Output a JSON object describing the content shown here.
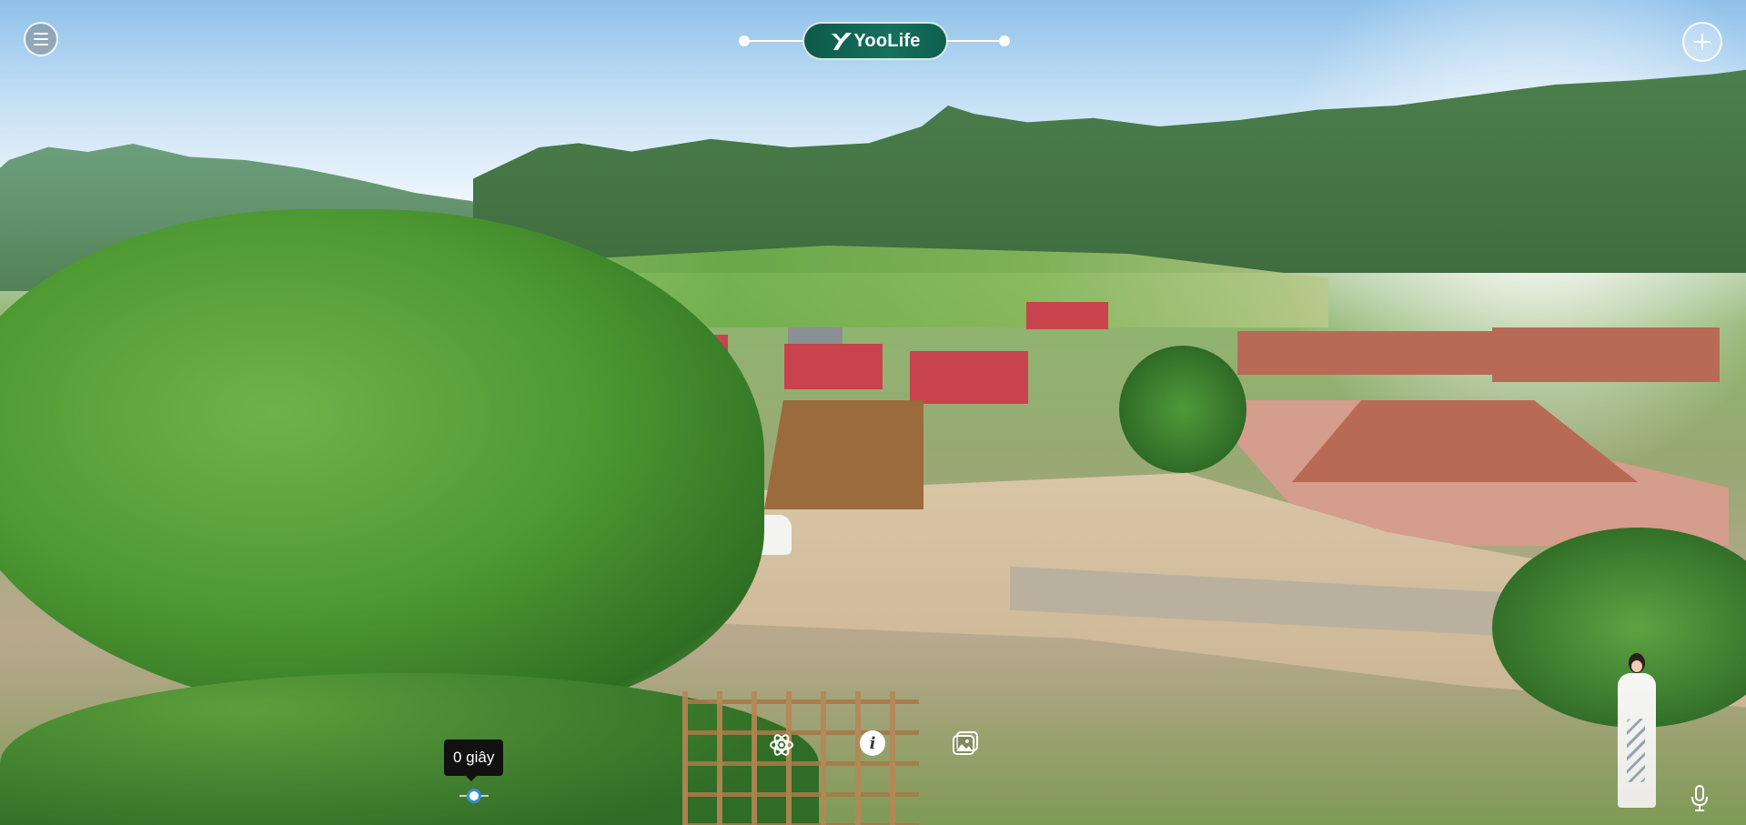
{
  "header": {
    "menu_icon": "hamburger-menu-icon",
    "logo_text": "YooLife",
    "logo_icon": "yoolife-logo-mark",
    "add_icon": "plus-icon"
  },
  "toolbar": {
    "settings_icon": "atom-icon",
    "info_icon": "info-icon",
    "info_glyph": "i",
    "gallery_icon": "photo-gallery-icon"
  },
  "timeline": {
    "tooltip": "0 giây",
    "value_fraction": 0
  },
  "guide": {
    "avatar_icon": "virtual-guide-avatar",
    "mic_icon": "microphone-icon"
  },
  "colors": {
    "logo_green": "#15705d",
    "slider_accent": "#3a8fd8"
  }
}
